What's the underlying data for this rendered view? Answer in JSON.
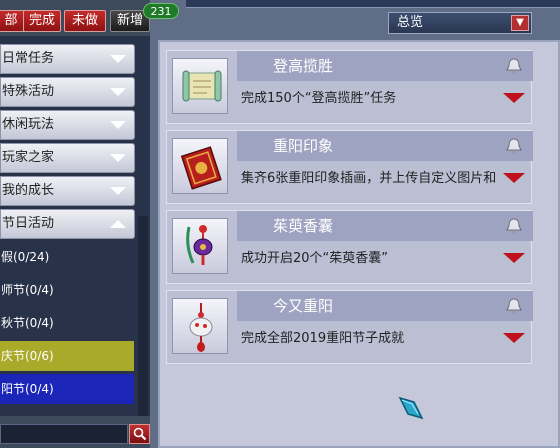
{
  "tabs": [
    {
      "label": "部"
    },
    {
      "label": "完成"
    },
    {
      "label": "未做"
    },
    {
      "label": "新增"
    }
  ],
  "new_count": "231",
  "filter": {
    "selected": "总览"
  },
  "categories": [
    {
      "label": "日常任务"
    },
    {
      "label": "特殊活动"
    },
    {
      "label": "休闲玩法"
    },
    {
      "label": "玩家之家"
    },
    {
      "label": "我的成长"
    },
    {
      "label": "节日活动"
    }
  ],
  "sub_items": [
    {
      "label": "假(0/24)"
    },
    {
      "label": "师节(0/4)"
    },
    {
      "label": "秋节(0/4)"
    },
    {
      "label": "庆节(0/6)"
    },
    {
      "label": "阳节(0/4)"
    }
  ],
  "achievements": [
    {
      "title": "登高揽胜",
      "desc": "完成150个“登高揽胜”任务",
      "icon": "scroll-icon"
    },
    {
      "title": "重阳印象",
      "desc": "集齐6张重阳印象插画，并上传自定义图片和",
      "icon": "book-icon"
    },
    {
      "title": "茱萸香囊",
      "desc": "成功开启20个“茱萸香囊”",
      "icon": "sachet-icon"
    },
    {
      "title": "今又重阳",
      "desc": "完成全部2019重阳节子成就",
      "icon": "ornament-icon"
    }
  ],
  "colors": {
    "tab_red": "#c42a2a",
    "highlight_yellow": "#a9a92a",
    "highlight_blue": "#1b26b8",
    "expand_red": "#c0101e"
  }
}
